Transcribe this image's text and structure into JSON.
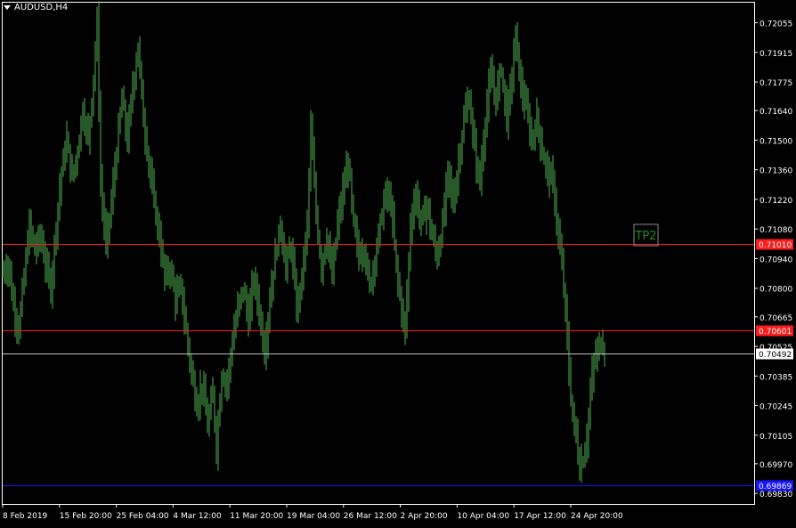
{
  "window": {
    "symbol_title": "AUDUSD,H4"
  },
  "colors": {
    "background": "#000000",
    "bars": "#4fb24f",
    "axis": "#ffffff",
    "level_red": "#ff1a1a",
    "level_blue": "#1414ff",
    "current": "#c0c0c0",
    "tp_text": "#1e8c1e"
  },
  "tp_label": "TP2",
  "chart_data": {
    "type": "ohlc",
    "title": "AUDUSD,H4",
    "ylim": [
      0.6978,
      0.7215
    ],
    "y_ticks": [
      "0.72055",
      "0.71915",
      "0.71775",
      "0.71640",
      "0.71500",
      "0.71360",
      "0.71220",
      "0.71080",
      "0.70940",
      "0.70800",
      "0.70665",
      "0.70525",
      "0.70385",
      "0.70245",
      "0.70105",
      "0.69970",
      "0.69830"
    ],
    "x_ticks": [
      "8 Feb 2019",
      "15 Feb 20:00",
      "25 Feb 04:00",
      "4 Mar 12:00",
      "11 Mar 20:00",
      "19 Mar 04:00",
      "26 Mar 12:00",
      "2 Apr 20:00",
      "10 Apr 04:00",
      "17 Apr 12:00",
      "24 Apr 20:00"
    ],
    "levels": [
      {
        "label": "0.71010",
        "value": 0.7101,
        "kind": "red"
      },
      {
        "label": "0.70601",
        "value": 0.70601,
        "kind": "red"
      },
      {
        "label": "0.70492",
        "value": 0.70492,
        "kind": "current"
      },
      {
        "label": "0.69869",
        "value": 0.69869,
        "kind": "blue"
      }
    ],
    "close_path": [
      [
        0,
        0.7088
      ],
      [
        6,
        0.7092
      ],
      [
        12,
        0.7072
      ],
      [
        18,
        0.7061
      ],
      [
        24,
        0.7085
      ],
      [
        30,
        0.711
      ],
      [
        36,
        0.7098
      ],
      [
        42,
        0.7105
      ],
      [
        48,
        0.7092
      ],
      [
        54,
        0.708
      ],
      [
        60,
        0.711
      ],
      [
        66,
        0.7135
      ],
      [
        72,
        0.715
      ],
      [
        78,
        0.7132
      ],
      [
        84,
        0.7145
      ],
      [
        90,
        0.7165
      ],
      [
        96,
        0.715
      ],
      [
        102,
        0.718
      ],
      [
        106,
        0.7205
      ],
      [
        110,
        0.713
      ],
      [
        116,
        0.71
      ],
      [
        122,
        0.712
      ],
      [
        128,
        0.7145
      ],
      [
        134,
        0.717
      ],
      [
        140,
        0.715
      ],
      [
        146,
        0.7175
      ],
      [
        152,
        0.7195
      ],
      [
        158,
        0.716
      ],
      [
        164,
        0.714
      ],
      [
        170,
        0.712
      ],
      [
        176,
        0.7105
      ],
      [
        182,
        0.7085
      ],
      [
        188,
        0.709
      ],
      [
        194,
        0.7075
      ],
      [
        200,
        0.708
      ],
      [
        206,
        0.706
      ],
      [
        212,
        0.704
      ],
      [
        218,
        0.7025
      ],
      [
        224,
        0.7035
      ],
      [
        230,
        0.7015
      ],
      [
        236,
        0.703
      ],
      [
        240,
        0.7005
      ],
      [
        246,
        0.704
      ],
      [
        252,
        0.7035
      ],
      [
        258,
        0.7055
      ],
      [
        264,
        0.707
      ],
      [
        270,
        0.708
      ],
      [
        276,
        0.7065
      ],
      [
        282,
        0.7085
      ],
      [
        288,
        0.707
      ],
      [
        294,
        0.705
      ],
      [
        300,
        0.7075
      ],
      [
        306,
        0.7095
      ],
      [
        312,
        0.711
      ],
      [
        318,
        0.709
      ],
      [
        324,
        0.71
      ],
      [
        330,
        0.707
      ],
      [
        336,
        0.7085
      ],
      [
        342,
        0.711
      ],
      [
        346,
        0.7155
      ],
      [
        352,
        0.7115
      ],
      [
        358,
        0.709
      ],
      [
        364,
        0.7105
      ],
      [
        370,
        0.7085
      ],
      [
        376,
        0.711
      ],
      [
        382,
        0.7125
      ],
      [
        388,
        0.714
      ],
      [
        394,
        0.711
      ],
      [
        400,
        0.7095
      ],
      [
        406,
        0.71
      ],
      [
        412,
        0.708
      ],
      [
        418,
        0.7095
      ],
      [
        424,
        0.711
      ],
      [
        430,
        0.7125
      ],
      [
        436,
        0.712
      ],
      [
        442,
        0.709
      ],
      [
        448,
        0.707
      ],
      [
        452,
        0.706
      ],
      [
        458,
        0.711
      ],
      [
        464,
        0.7125
      ],
      [
        470,
        0.711
      ],
      [
        476,
        0.712
      ],
      [
        482,
        0.7105
      ],
      [
        488,
        0.7095
      ],
      [
        494,
        0.711
      ],
      [
        500,
        0.7135
      ],
      [
        506,
        0.712
      ],
      [
        512,
        0.714
      ],
      [
        518,
        0.716
      ],
      [
        524,
        0.717
      ],
      [
        530,
        0.7145
      ],
      [
        536,
        0.713
      ],
      [
        542,
        0.716
      ],
      [
        548,
        0.718
      ],
      [
        554,
        0.717
      ],
      [
        560,
        0.7185
      ],
      [
        566,
        0.716
      ],
      [
        572,
        0.718
      ],
      [
        576,
        0.72
      ],
      [
        582,
        0.7175
      ],
      [
        588,
        0.7165
      ],
      [
        594,
        0.715
      ],
      [
        600,
        0.716
      ],
      [
        606,
        0.7145
      ],
      [
        612,
        0.7135
      ],
      [
        618,
        0.713
      ],
      [
        624,
        0.7105
      ],
      [
        628,
        0.709
      ],
      [
        632,
        0.707
      ],
      [
        636,
        0.704
      ],
      [
        640,
        0.702
      ],
      [
        644,
        0.701
      ],
      [
        648,
        0.6995
      ],
      [
        652,
        0.7
      ],
      [
        656,
        0.701
      ],
      [
        660,
        0.703
      ],
      [
        664,
        0.7045
      ],
      [
        668,
        0.705
      ],
      [
        672,
        0.7055
      ],
      [
        677,
        0.7052
      ]
    ]
  }
}
